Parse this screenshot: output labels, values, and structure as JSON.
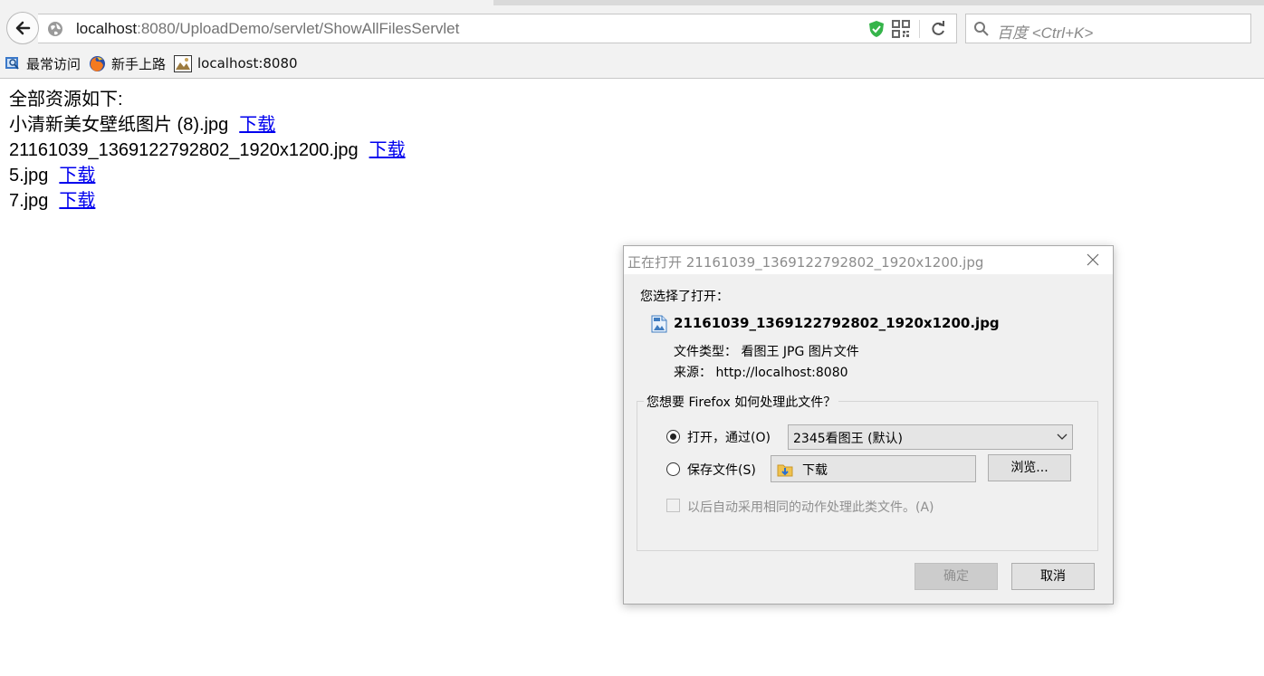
{
  "browser": {
    "url_host": "localhost",
    "url_rest": ":8080/UploadDemo/servlet/ShowAllFilesServlet",
    "search_placeholder": "百度 <Ctrl+K>",
    "bookmarks": [
      {
        "label": "最常访问",
        "icon": "most-visited-icon"
      },
      {
        "label": "新手上路",
        "icon": "firefox-icon"
      },
      {
        "label": "localhost:8080",
        "icon": "page-icon"
      }
    ]
  },
  "page": {
    "heading": "全部资源如下:",
    "files": [
      {
        "name": "小清新美女壁纸图片 (8).jpg",
        "link": "下载"
      },
      {
        "name": "21161039_1369122792802_1920x1200.jpg",
        "link": "下载"
      },
      {
        "name": "5.jpg",
        "link": "下载"
      },
      {
        "name": "7.jpg",
        "link": "下载"
      }
    ]
  },
  "dialog": {
    "title": "正在打开 21161039_1369122792802_1920x1200.jpg",
    "prompt": "您选择了打开：",
    "filename": "21161039_1369122792802_1920x1200.jpg",
    "filetype_label": "文件类型：",
    "filetype_value": "看图王 JPG 图片文件",
    "source_label": "来源：",
    "source_value": "http://localhost:8080",
    "group_label": "您想要 Firefox 如何处理此文件？",
    "open_with_label": "打开，通过(O)",
    "open_with_value": "2345看图王 (默认)",
    "save_label": "保存文件(S)",
    "save_folder": "下载",
    "browse_label": "浏览...",
    "remember_label": "以后自动采用相同的动作处理此类文件。(A)",
    "ok_label": "确定",
    "cancel_label": "取消",
    "selected_action": "open"
  }
}
